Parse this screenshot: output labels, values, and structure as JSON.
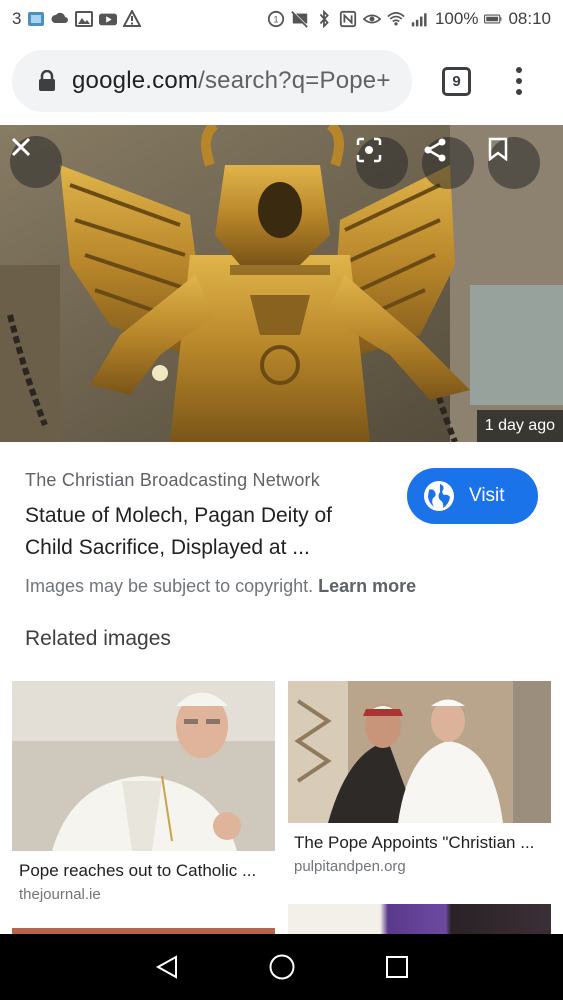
{
  "status_bar": {
    "left_count": "3",
    "battery": "100%",
    "time": "08:10"
  },
  "url_bar": {
    "domain": "google.com",
    "path": "/search?q=Pope+"
  },
  "tabs": {
    "count": "9"
  },
  "hero": {
    "time_ago": "1 day ago"
  },
  "result": {
    "source": "The Christian Broadcasting Network",
    "title_line1": "Statue of Molech, Pagan Deity of",
    "title_line2": "Child Sacrifice, Displayed at ...",
    "visit_label": "Visit",
    "copyright_text": "Images may be subject to copyright.",
    "learn_more": "Learn more"
  },
  "related": {
    "heading": "Related images",
    "items": [
      {
        "caption": "Pope reaches out to Catholic ...",
        "domain": "thejournal.ie"
      },
      {
        "caption": "The Pope Appoints \"Christian ...",
        "domain": "pulpitandpen.org"
      }
    ]
  },
  "colors": {
    "accent": "#1a73e8",
    "url_bar_bg": "#f1f3f4",
    "nav_bar_bg": "#000000"
  }
}
